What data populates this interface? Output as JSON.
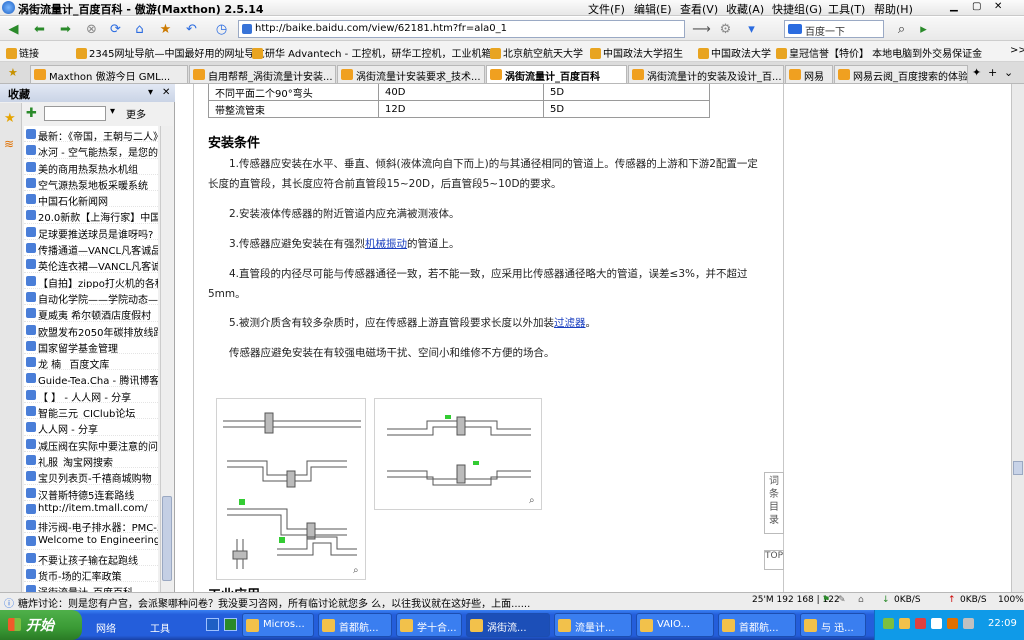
{
  "window": {
    "title": "涡街流量计_百度百科 - 傲游(Maxthon) 2.5.14",
    "menu": [
      "文件(F)",
      "编辑(E)",
      "查看(V)",
      "收藏(A)",
      "快捷组(G)",
      "工具(T)",
      "帮助(H)"
    ]
  },
  "toolbar": {
    "address": "http://baike.baidu.com/view/62181.htm?fr=ala0_1",
    "search_placeholder": "百度一下"
  },
  "bookmarks": [
    "链接",
    "2345网址导航—中国最好用的网址导航",
    "研华 Advantech - 工控机，研华工控机，工业机箱...",
    "北京航空航天大学",
    "中国政法大学招生",
    "中国政法大学",
    "皇冠信誉【特价】 本地电脑到外交易保证金",
    ">>"
  ],
  "tabs": [
    "Maxthon 傲游今日 GML...",
    "自用帮帮_涡街流量计安装...",
    "涡街流量计安装要求_技术...",
    "涡街流量计_百度百科",
    "涡街流量计的安装及设计_百...",
    "网易",
    "网易云阅_百度搜索的体验门户"
  ],
  "sidebar": {
    "title": "收藏",
    "more_label": "更多",
    "items": [
      "最新：《帝国，王朝与二人》",
      "冰河 - 空气能热泵，是您的...",
      "美的商用热泵热水机组",
      "空气源热泵地板采暖系统",
      "中国石化新闻网",
      "20.0新款【上海行家】中国...",
      "足球要推送球员是谁呀吗?",
      "传播通道—VANCL凡客诚品",
      "英伦连衣裙—VANCL凡客诚品",
      "【自拍】zippo打火机的各种玩法",
      "自动化学院——学院动态—新闻",
      "夏威夷 希尔顿酒店度假村",
      "欧盟发布2050年碳排放线路图",
      "国家留学基金管理",
      "龙 楠 _百度文库",
      "Guide-Tea.Cha - 腾讯博客",
      "【 】 - 人人网 - 分享",
      "智能三元_CIClub论坛",
      "人人网 - 分享",
      "减压阀在实际中要注意的问题",
      "礼服_淘宝网搜索",
      "宝贝列表页-千禧商城购物",
      "汉普斯特德5连套路线",
      "http://item.tmall.com/",
      "排污阀-电子排水器：PMC-5",
      "Welcome to Engineering",
      "不要让孩子输在起跑线",
      "货币-场的汇率政策",
      "涡街流量计_百度百科"
    ]
  },
  "article": {
    "table_rows": [
      [
        "不同平面二个90°弯头",
        "40D",
        "5D"
      ],
      [
        "带整流管束",
        "12D",
        "5D"
      ]
    ],
    "section_title": "安装条件",
    "p1": "1.传感器应安装在水平、垂直、倾斜(液体流向自下而上)的与其通径相同的管道上。传感器的上游和下游2配置一定长度的直管段，其长度应符合前直管段15~20D，后直管段5~10D的要求。",
    "p2": "2.安装液体传感器的附近管道内应充满被测液体。",
    "p3a": "3.传感器应避免安装在有强烈",
    "p3_link": "机械振动",
    "p3b": "的管道上。",
    "p4": "4.直管段的内径尽可能与传感器通径一致，若不能一致，应采用比传感器通径略大的管道，误差≤3%，并不超过5mm。",
    "p5a": "5.被测介质含有较多杂质时，应在传感器上游直管段要求长度以外加装",
    "p5_link": "过滤器",
    "p5b": "。",
    "p6": "传感器应避免安装在有较强电磁场干扰、空间小和维修不方便的场合。",
    "section2_title": "工业应用",
    "toc_label": "词条目录",
    "top_label": "TOP"
  },
  "status": {
    "message": "糖炸讨论：则是您有户宫，会派聚哪种问卷？我没要习咨网，所有临讨论就您多 么，以往我议就在这好些，上面......",
    "info": "25'M 192 168 | 122",
    "down": "0KB/S",
    "up": "0KB/S",
    "zoom": "100%"
  },
  "taskbar": {
    "start_label": "开始",
    "quick": [
      "网络",
      "工具"
    ],
    "buttons": [
      "Micros...",
      "首都航...",
      "学十合...",
      "涡街流...",
      "流量计...",
      "VAIO...",
      "首都航...",
      "与 迅..."
    ],
    "clock": "22:09"
  }
}
